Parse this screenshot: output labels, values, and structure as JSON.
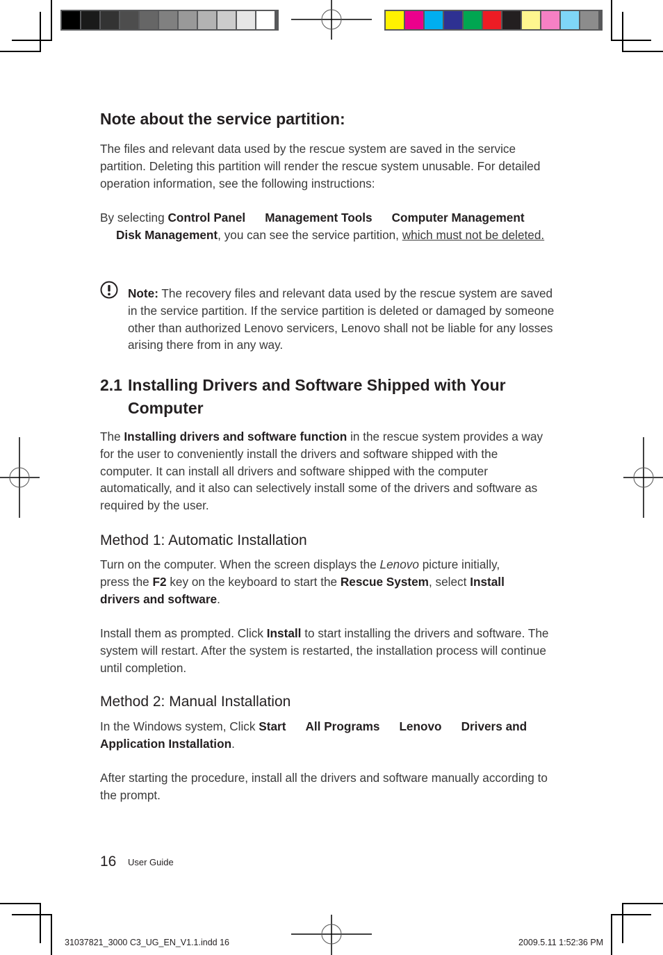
{
  "print_marks": {
    "grayscale_swatches": [
      "#000000",
      "#1a1a1a",
      "#333333",
      "#4d4d4d",
      "#666666",
      "#808080",
      "#999999",
      "#b3b3b3",
      "#cccccc",
      "#e6e6e6",
      "#ffffff"
    ],
    "color_swatches": [
      "#fff200",
      "#ec008c",
      "#00aeef",
      "#2e3192",
      "#00a651",
      "#ed1c24",
      "#231f20",
      "#fff68f",
      "#f680c4",
      "#7fd6f7",
      "#8c8c8c"
    ]
  },
  "note_section": {
    "title": "Note about the service partition:",
    "intro": "The files and relevant data used by the rescue system are saved in the service partition. Deleting this partition will render the rescue system unusable. For detailed operation information, see the following instructions:",
    "path_prefix": "By selecting ",
    "path_items": [
      "Control Panel",
      "Management Tools",
      "Computer Management",
      "Disk Management"
    ],
    "path_suffix": ", you can see the service partition, ",
    "warning_link": "which must not be deleted.",
    "note_label": "Note:",
    "note_text": " The recovery files and relevant data used by the rescue system are saved in the service partition. If the service partition is deleted or damaged by someone other than authorized Lenovo servicers, Lenovo shall not be liable for any losses arising there from in any way."
  },
  "section_2_1": {
    "number": "2.1",
    "title": "Installing Drivers and Software Shipped with Your Computer",
    "intro_pre": "The ",
    "intro_bold": "Installing drivers and software function",
    "intro_post": " in the rescue system provides a way for the user to conveniently install the drivers and software shipped with the computer. It can install all drivers and software shipped with the computer automatically, and it also can selectively install some of the drivers and software as required by the user.",
    "method1": {
      "heading": "Method 1: Automatic Installation",
      "p1_a": "Turn on the computer. When the screen displays the ",
      "p1_italic": "Lenovo",
      "p1_b": " picture initially, press the ",
      "p1_key": "F2",
      "p1_c": " key on the keyboard to start the ",
      "p1_bold1": "Rescue System",
      "p1_d": ", select ",
      "p1_bold2": "Install drivers and software",
      "p1_e": ".",
      "p2_a": "Install them as prompted. Click ",
      "p2_bold": "Install",
      "p2_b": " to start installing the drivers and software. The system will restart. After the system is restarted, the installation process will continue until completion."
    },
    "method2": {
      "heading": "Method 2: Manual Installation",
      "p1_prefix": "In the Windows system, Click ",
      "path_items": [
        "Start",
        "All Programs",
        "Lenovo",
        "Drivers and Application Installation"
      ],
      "p1_suffix": ".",
      "p2": "After starting the procedure, install all the drivers and software manually according to the prompt."
    }
  },
  "footer": {
    "page_number": "16",
    "label": "User Guide",
    "slug_file": "31037821_3000 C3_UG_EN_V1.1.indd   16",
    "slug_date": "2009.5.11   1:52:36 PM"
  }
}
